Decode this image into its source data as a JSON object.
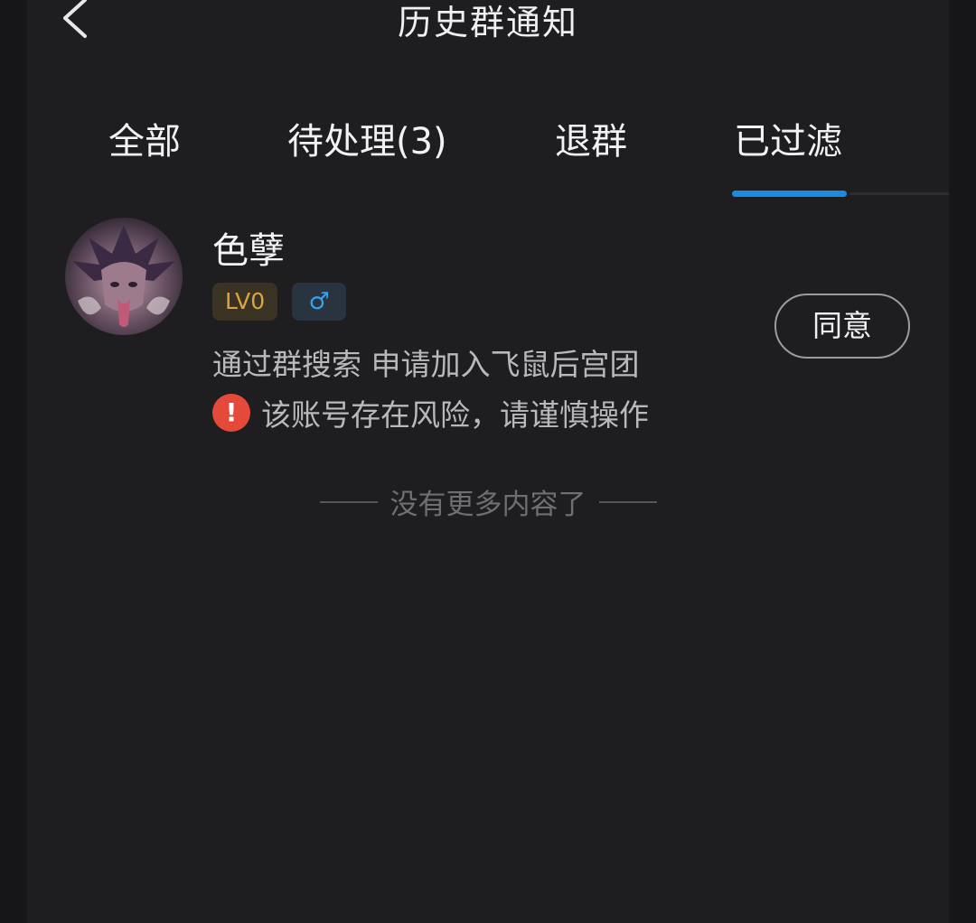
{
  "header": {
    "title": "历史群通知"
  },
  "tabs": [
    {
      "label": "全部"
    },
    {
      "label": "待处理(3)"
    },
    {
      "label": "退群"
    },
    {
      "label": "已过滤"
    }
  ],
  "active_tab": "已过滤",
  "colors": {
    "accent": "#1b8be0",
    "warning": "#e5493a",
    "level_badge": "#d9a441",
    "gender_badge": "#3ba0ea",
    "background": "#1e1e20"
  },
  "request": {
    "name": "色孽",
    "level_badge": "LV0",
    "gender_symbol": "♂",
    "message": "通过群搜索 申请加入飞鼠后宫团",
    "warning_symbol": "!",
    "warning_text": "该账号存在风险，请谨慎操作",
    "agree_label": "同意",
    "avatar_icon": "character-avatar"
  },
  "end_text": "没有更多内容了"
}
